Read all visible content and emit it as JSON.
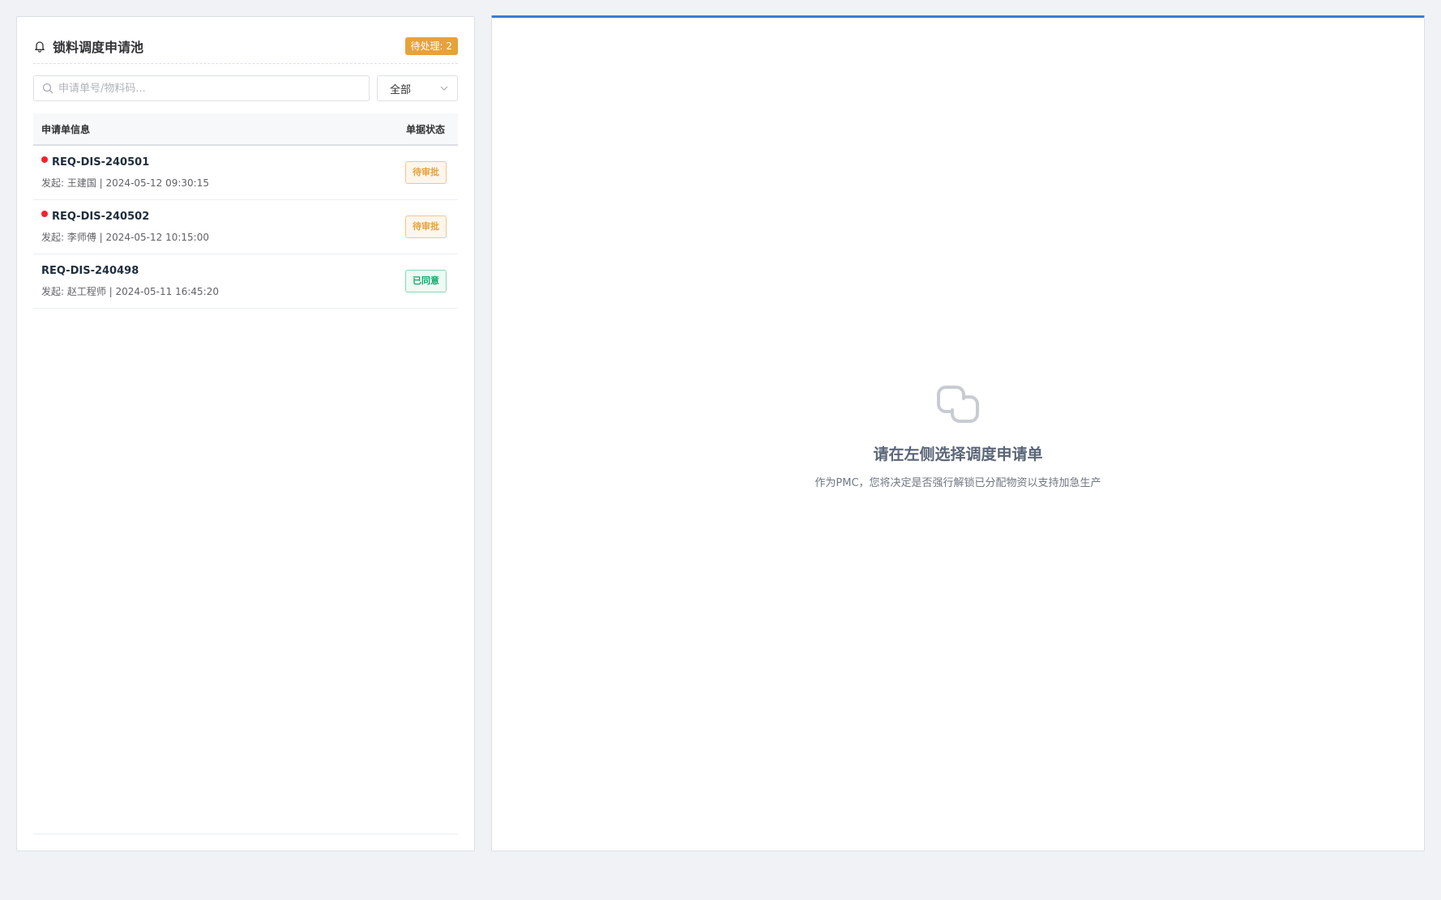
{
  "sidebar": {
    "title": "锁料调度申请池",
    "pending_badge": "待处理: 2",
    "search": {
      "placeholder": "申请单号/物料码...",
      "value": ""
    },
    "filter": {
      "selected": "全部"
    },
    "columns": {
      "info": "申请单信息",
      "status": "单据状态"
    },
    "rows": [
      {
        "id": "REQ-DIS-240501",
        "meta": "发起: 王建国 | 2024-05-12 09:30:15",
        "status": "待审批",
        "status_type": "pending",
        "unread": true
      },
      {
        "id": "REQ-DIS-240502",
        "meta": "发起: 李师傅 | 2024-05-12 10:15:00",
        "status": "待审批",
        "status_type": "pending",
        "unread": true
      },
      {
        "id": "REQ-DIS-240498",
        "meta": "发起: 赵工程师 | 2024-05-11 16:45:20",
        "status": "已同意",
        "status_type": "approved",
        "unread": false
      }
    ]
  },
  "main": {
    "empty_title": "请在左侧选择调度申请单",
    "empty_desc": "作为PMC，您将决定是否强行解锁已分配物资以支持加急生产"
  },
  "colors": {
    "accent": "#3a7bd5",
    "pending": "#e6a23c",
    "approved": "#13a86e",
    "unread_dot": "#f5222d"
  },
  "icons": [
    "bell-icon",
    "search-icon",
    "chevron-down-icon",
    "link-icon"
  ]
}
